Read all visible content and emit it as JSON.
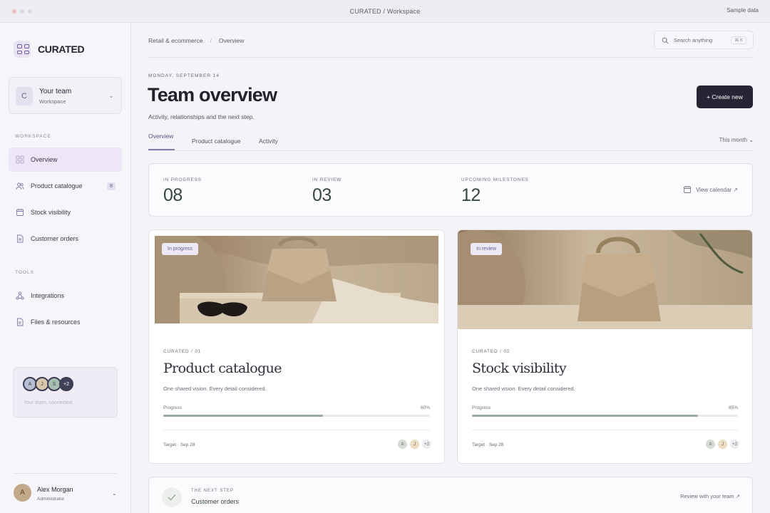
{
  "window": {
    "title": "CURATED / Workspace",
    "sample_label": "Sample data"
  },
  "brand": {
    "name": "CURATED"
  },
  "team": {
    "initial": "C",
    "name": "Your team",
    "sub": "Workspace"
  },
  "sidebar": {
    "workspace_label": "WORKSPACE",
    "tools_label": "TOOLS",
    "items": [
      {
        "label": "Overview"
      },
      {
        "label": "Product catalogue",
        "badge": "8"
      },
      {
        "label": "Stock visibility"
      },
      {
        "label": "Customer orders"
      },
      {
        "label": "Integrations"
      },
      {
        "label": "Files & resources"
      }
    ],
    "promo": {
      "avatars": [
        "A",
        "J",
        "S",
        "+2"
      ],
      "text": "Your team, connected."
    },
    "user": {
      "initial": "A",
      "name": "Alex Morgan",
      "role": "Administrator"
    }
  },
  "header": {
    "breadcrumb": [
      "Retail & ecommerce",
      "Overview"
    ],
    "breadcrumb_sep": "/",
    "search_placeholder": "Search anything",
    "search_kbd": "⌘ K",
    "date": "MONDAY, SEPTEMBER 14",
    "title": "Team overview",
    "subtitle": "Activity, relationships and the next step.",
    "create_label": "+ Create new"
  },
  "tabs": {
    "items": [
      "Overview",
      "Product catalogue",
      "Activity"
    ],
    "period": "This month ⌄"
  },
  "stats": [
    {
      "label": "IN PROGRESS",
      "value": "08"
    },
    {
      "label": "IN REVIEW",
      "value": "03"
    },
    {
      "label": "UPCOMING MILESTONES",
      "value": "12"
    }
  ],
  "calendar_link": "View calendar ↗",
  "cards": [
    {
      "badge": "In progress",
      "code": "CURATED / 01",
      "title": "Product catalogue",
      "desc": "One shared vision. Every detail considered.",
      "progress_label": "Progress",
      "progress_pct": "60%",
      "progress": 0.6,
      "target": "Target · Sep 28",
      "avatars": [
        "A",
        "J",
        "+2"
      ]
    },
    {
      "badge": "In review",
      "code": "CURATED / 02",
      "title": "Stock visibility",
      "desc": "One shared vision. Every detail considered.",
      "progress_label": "Progress",
      "progress_pct": "85%",
      "progress": 0.85,
      "target": "Target · Sep 28",
      "avatars": [
        "A",
        "J",
        "+2"
      ]
    }
  ],
  "next_step": {
    "label": "THE NEXT STEP",
    "title": "Customer orders",
    "link": "Review with your team ↗"
  }
}
